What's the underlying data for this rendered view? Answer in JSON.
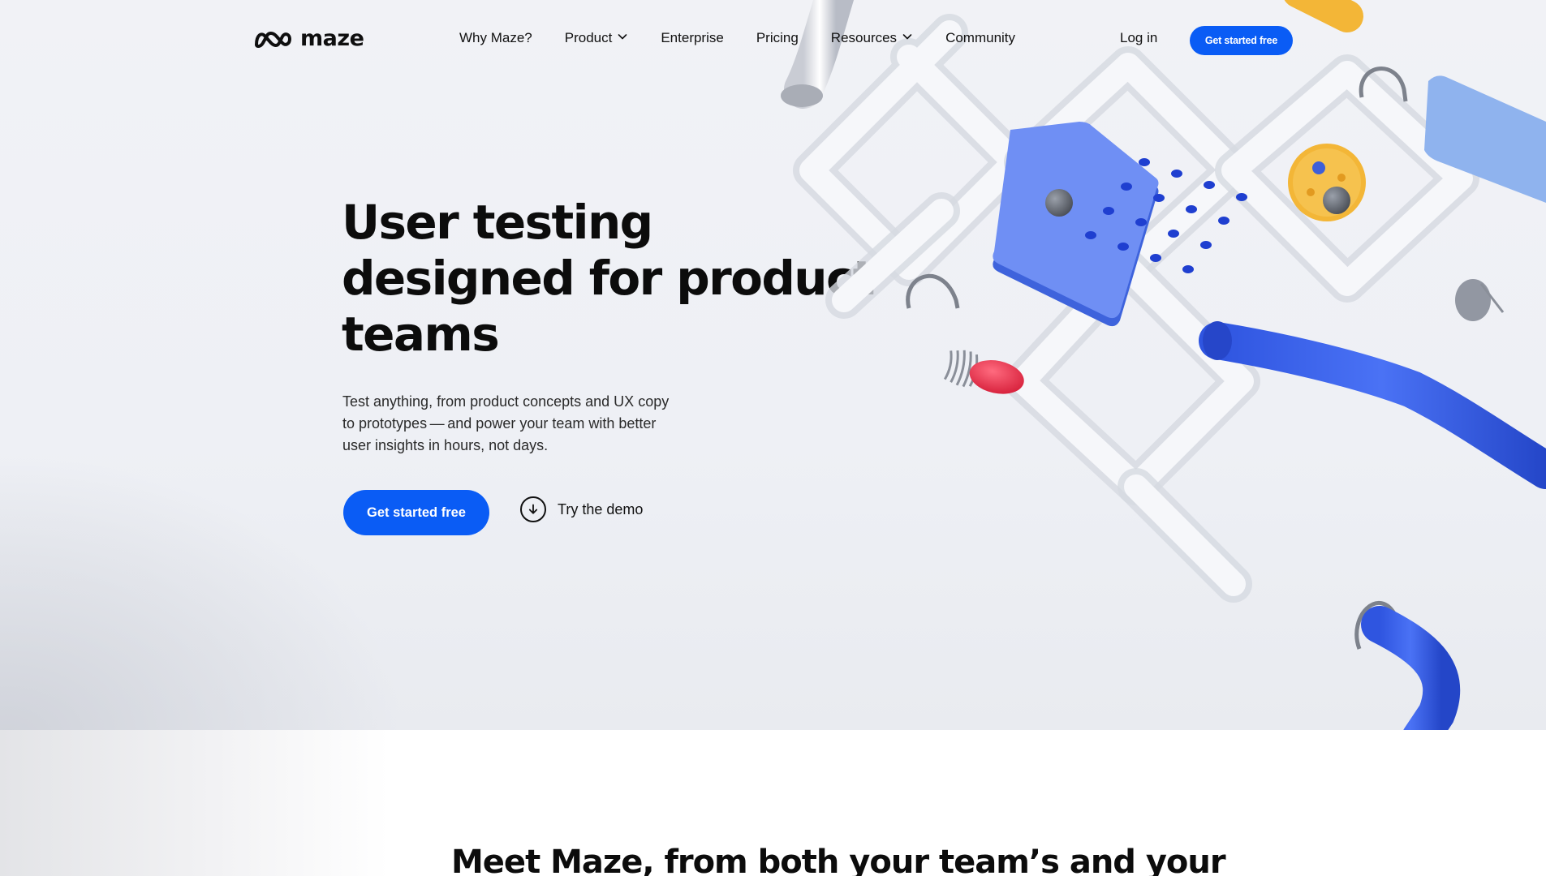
{
  "nav": {
    "logo_text": "maze",
    "links": [
      {
        "label": "Why Maze?",
        "has_dropdown": false
      },
      {
        "label": "Product",
        "has_dropdown": true
      },
      {
        "label": "Enterprise",
        "has_dropdown": false
      },
      {
        "label": "Pricing",
        "has_dropdown": false
      },
      {
        "label": "Resources",
        "has_dropdown": true
      },
      {
        "label": "Community",
        "has_dropdown": false
      }
    ],
    "login_label": "Log in",
    "cta_label": "Get started free"
  },
  "hero": {
    "headline": "User testing designed for product teams",
    "subtext": "Test anything, from product concepts and UX copy to prototypes — and power your team with better user insights in hours, not days.",
    "primary_cta": "Get started free",
    "demo_cta": "Try the demo",
    "demo_icon": "arrow-down-circle-icon"
  },
  "next_section": {
    "heading": "Meet Maze, from both your team’s and your"
  },
  "colors": {
    "brand_blue": "#0a5cf5",
    "hero_bg": "#eff1f5",
    "text": "#0f0f0f"
  }
}
